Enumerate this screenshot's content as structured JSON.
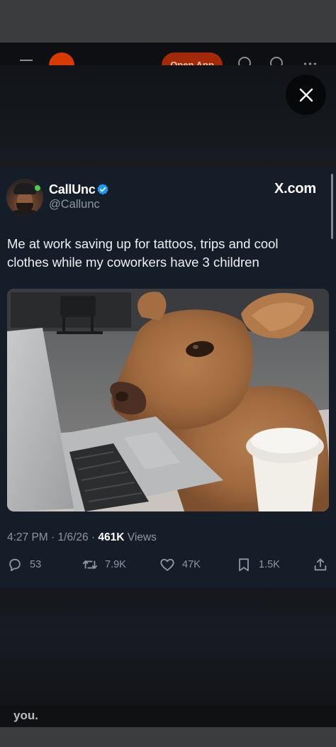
{
  "background_app": {
    "open_app_label": "Open App",
    "bottom_text": "you."
  },
  "tweet": {
    "author_name": "CallUnc",
    "author_handle": "@Callunc",
    "source": "X.com",
    "text": "Me at work saving up for tattoos, trips and cool clothes while my coworkers have 3 children",
    "time": "4:27 PM",
    "date": "1/6/26",
    "views_count": "461K",
    "views_label": "Views",
    "replies": "53",
    "reposts": "7.9K",
    "likes": "47K",
    "bookmarks": "1.5K"
  },
  "colors": {
    "card_bg": "#151d28",
    "verified_blue": "#1d9bf0",
    "muted_text": "#8b98a5"
  }
}
